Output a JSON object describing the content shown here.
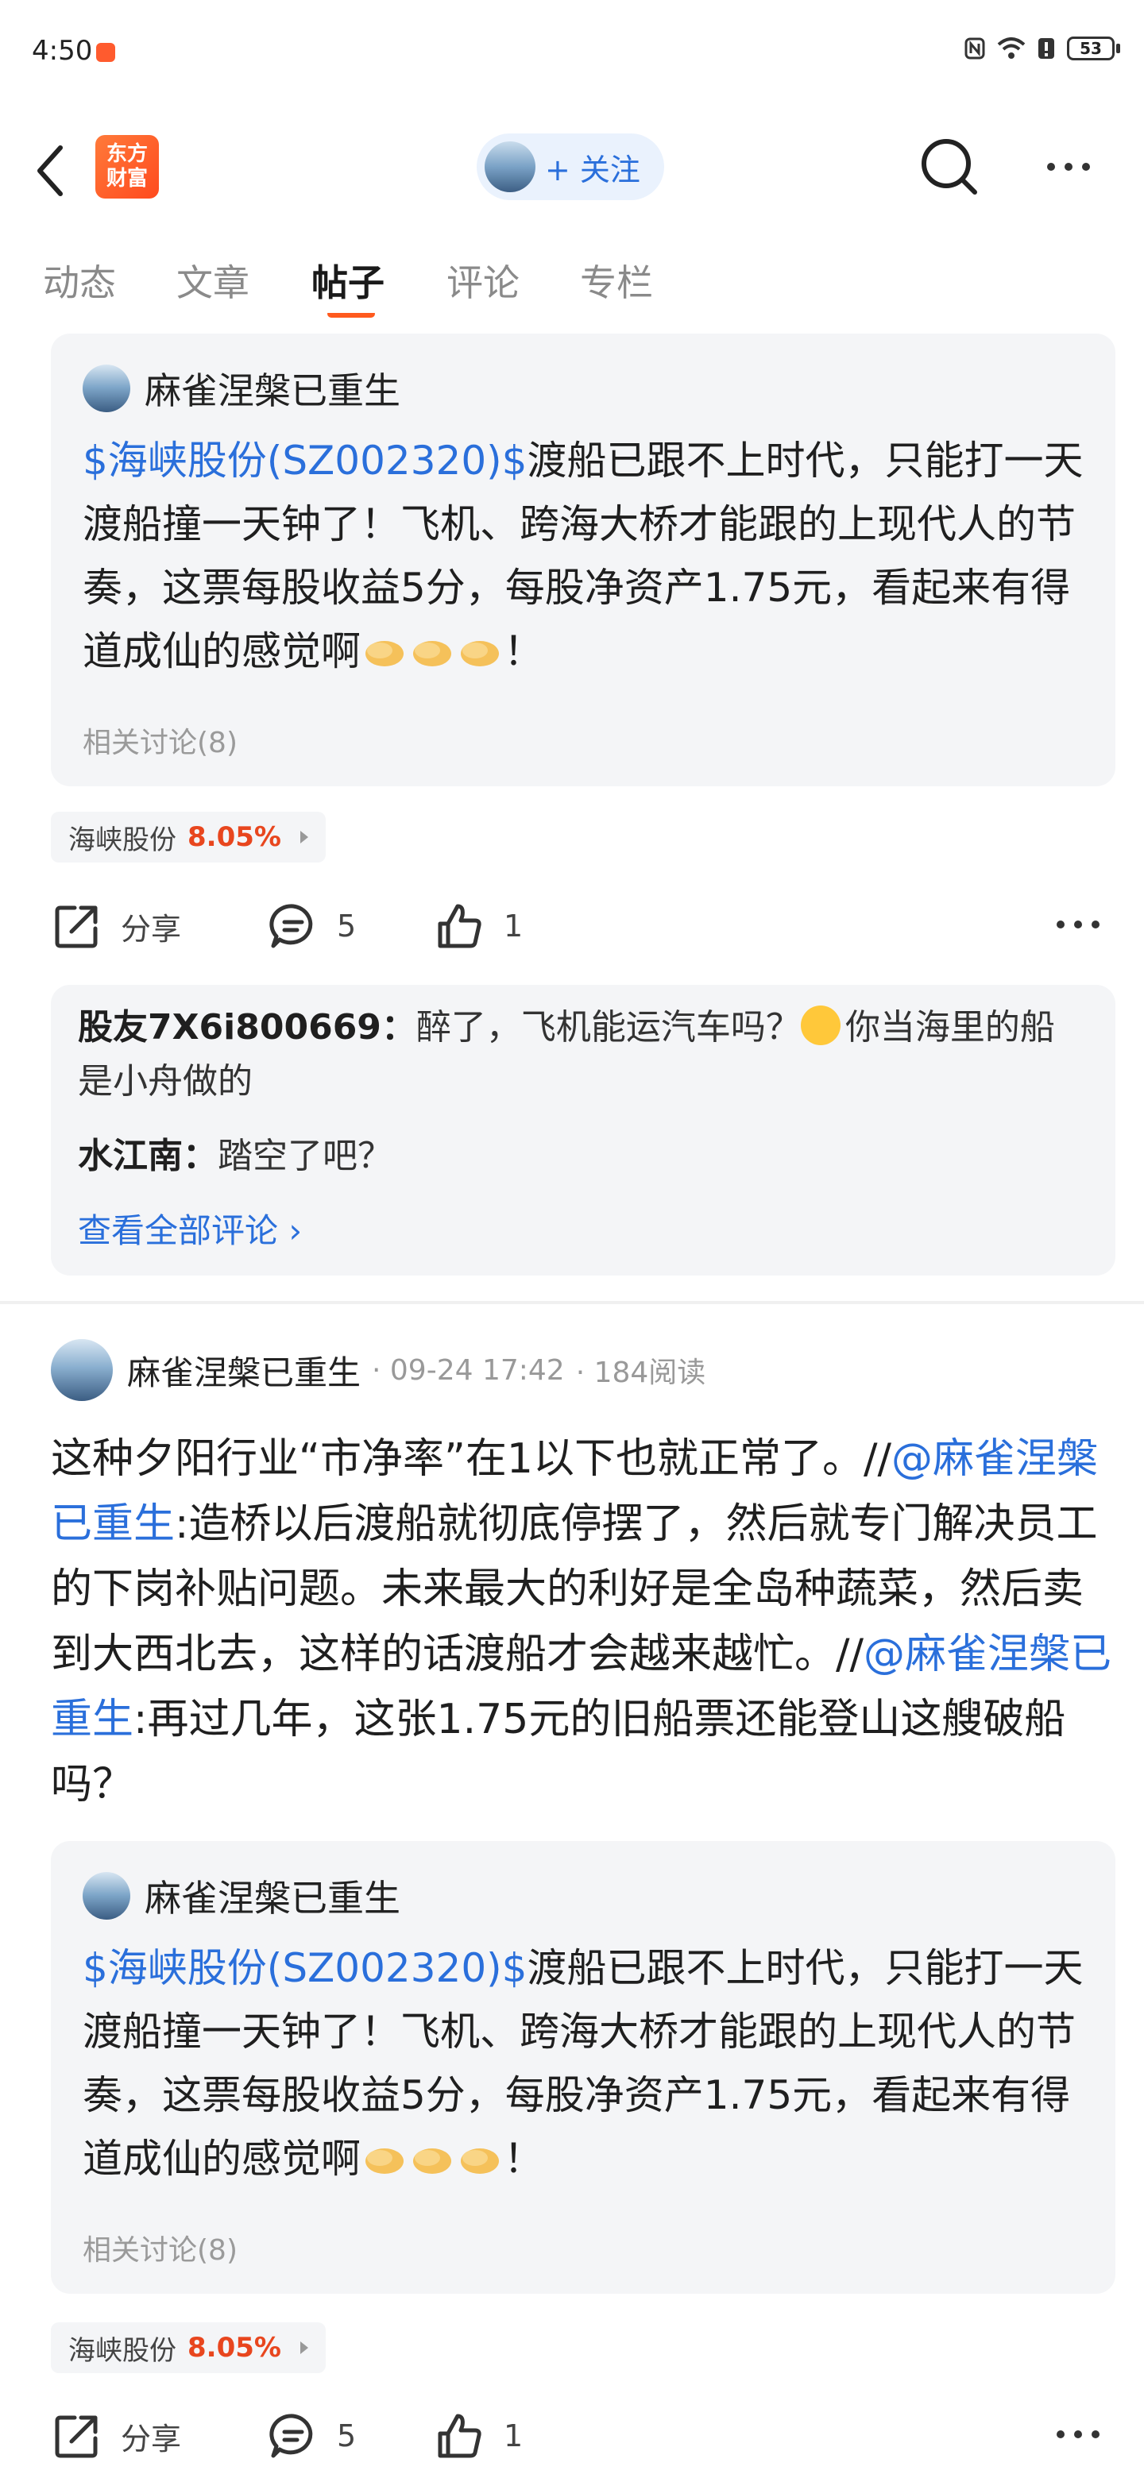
{
  "status": {
    "time": "4:50",
    "battery": "53"
  },
  "header": {
    "logo_line1": "东方",
    "logo_line2": "财富",
    "follow_label": "+ 关注"
  },
  "tabs": [
    {
      "label": "动态"
    },
    {
      "label": "文章"
    },
    {
      "label": "帖子"
    },
    {
      "label": "评论"
    },
    {
      "label": "专栏"
    }
  ],
  "post1": {
    "quote": {
      "author": "麻雀涅槃已重生",
      "stock_link": "$海峡股份(SZ002320)$",
      "text_line1": "渡船已跟不上时代，只能打",
      "text_rest": "一天渡船撞一天钟了！飞机、跨海大桥才能跟的上现代人的节奏，这票每股收益5分，每股净资产1.75元，看起来有得道成仙的感觉啊",
      "text_end": "！",
      "related": "相关讨论(8)"
    },
    "stock_chip": {
      "name": "海峡股份",
      "pct": "8.05%"
    },
    "actions": {
      "share": "分享",
      "comments": "5",
      "likes": "1"
    },
    "comments": [
      {
        "author": "股友7X6i800669",
        "text_pre": "醉了，飞机能运汽车吗？",
        "text_post": "你当海里的船是小舟做的"
      },
      {
        "author": "水江南",
        "text_pre": "踏空了吧？",
        "text_post": ""
      }
    ],
    "view_all": "查看全部评论 ›"
  },
  "post2": {
    "author": "麻雀涅槃已重生",
    "date": "· 09-24 17:42",
    "reads": "· 184阅读",
    "body_1": "这种夕阳行业“市净率”在1以下也就正常了。//",
    "mention_1": "@麻雀涅槃已重生",
    "body_2": ":造桥以后渡船就彻底停摆了，然后就专门解决员工的下岗补贴问题。未来最大的利好是全岛种蔬菜，然后卖到大西北去，这样的话渡船才会越来越忙。//",
    "mention_2": "@麻雀涅槃已重生",
    "body_3": ":再过几年，这张1.75元的旧船票还能登山这艘破船吗？",
    "quote": {
      "author": "麻雀涅槃已重生",
      "stock_link": "$海峡股份(SZ002320)$",
      "text_line1": "渡船已跟不上时代，只能打",
      "text_rest": "一天渡船撞一天钟了！飞机、跨海大桥才能跟的上现代人的节奏，这票每股收益5分，每股净资产1.75元，看起来有得道成仙的感觉啊",
      "text_end": "！",
      "related": "相关讨论(8)"
    },
    "stock_chip": {
      "name": "海峡股份",
      "pct": "8.05%"
    },
    "actions": {
      "share": "分享",
      "comments": "5",
      "likes": "1"
    }
  }
}
